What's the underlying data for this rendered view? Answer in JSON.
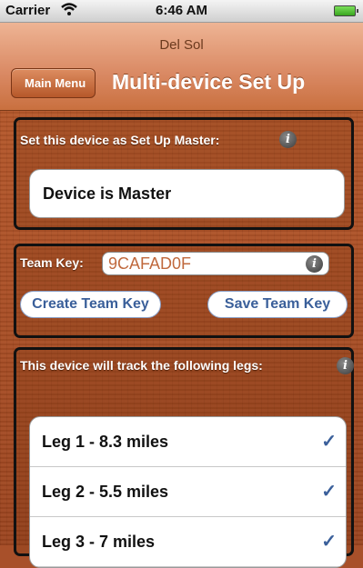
{
  "status": {
    "carrier": "Carrier",
    "time": "6:46 AM"
  },
  "nav": {
    "prompt": "Del Sol",
    "back_label": "Main Menu",
    "title": "Multi-device Set Up"
  },
  "master": {
    "label": "Set this device as Set Up Master:",
    "button": "Device is Master"
  },
  "team": {
    "label": "Team Key:",
    "key_value": "9CAFAD0F",
    "create_label": "Create Team Key",
    "save_label": "Save Team Key"
  },
  "legs": {
    "label": "This device will track the following legs:",
    "items": [
      {
        "name": "Leg 1 - 8.3 miles",
        "checked": true
      },
      {
        "name": "Leg 2 - 5.5 miles",
        "checked": true
      },
      {
        "name": "Leg 3 - 7 miles",
        "checked": true
      }
    ]
  },
  "colors": {
    "accent": "#3a5f9a",
    "wood": "#a8502a",
    "nav": "#d98862"
  }
}
